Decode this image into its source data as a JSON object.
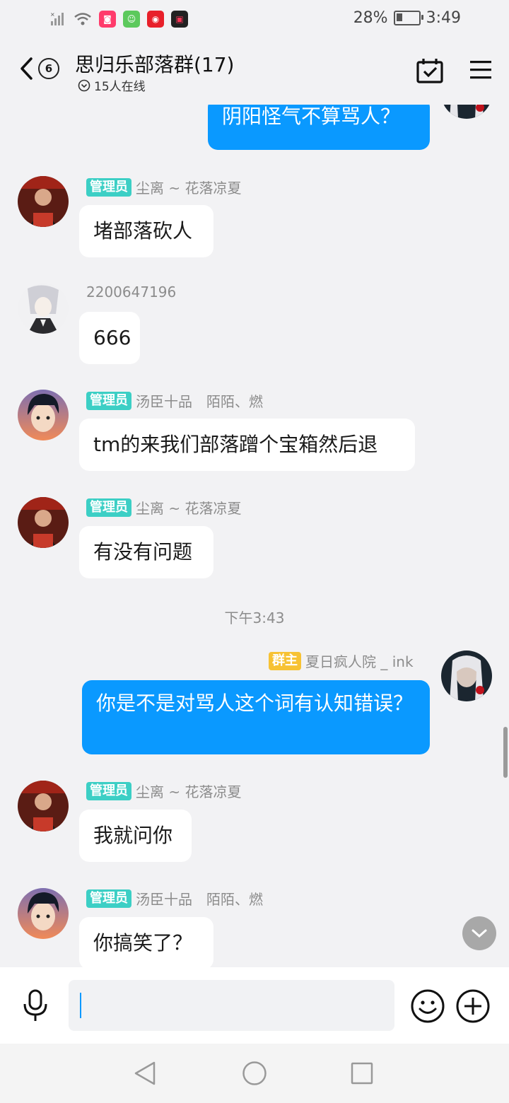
{
  "status_bar": {
    "battery_percent": "28%",
    "battery_level": 0.28,
    "time": "3:49",
    "icons": [
      "signal-icon",
      "wifi-icon",
      "app-icon-red",
      "app-icon-green",
      "app-icon-netease",
      "app-icon-video"
    ]
  },
  "header": {
    "unread_count": "6",
    "title": "思归乐部落群(17)",
    "online_text": "15人在线"
  },
  "messages": [
    {
      "type": "me",
      "text": "阴阳怪气不算骂人？"
    },
    {
      "type": "other",
      "badge": "管理员",
      "name": "尘离 ~ 花落凉夏",
      "text": "堵部落砍人"
    },
    {
      "type": "other",
      "name": "2200647196",
      "text": "666"
    },
    {
      "type": "other",
      "badge": "管理员",
      "name": "汤臣十品　陌陌、燃",
      "text": "tm的来我们部落蹭个宝箱然后退"
    },
    {
      "type": "other",
      "badge": "管理员",
      "name": "尘离 ~ 花落凉夏",
      "text": "有没有问题"
    },
    {
      "type": "time",
      "text": "下午3:43"
    },
    {
      "type": "me",
      "badge": "群主",
      "name": "夏日疯人院 _ ink",
      "text": "你是不是对骂人这个词有认知错误？"
    },
    {
      "type": "other",
      "badge": "管理员",
      "name": "尘离 ~ 花落凉夏",
      "text": "我就问你"
    },
    {
      "type": "other",
      "badge": "管理员",
      "name": "汤臣十品　陌陌、燃",
      "text": "你搞笑了？"
    }
  ],
  "colors": {
    "my_bubble": "#0a99ff",
    "admin_badge": "#3ccfc5",
    "owner_badge": "#f7c234",
    "background": "#f2f2f4"
  }
}
